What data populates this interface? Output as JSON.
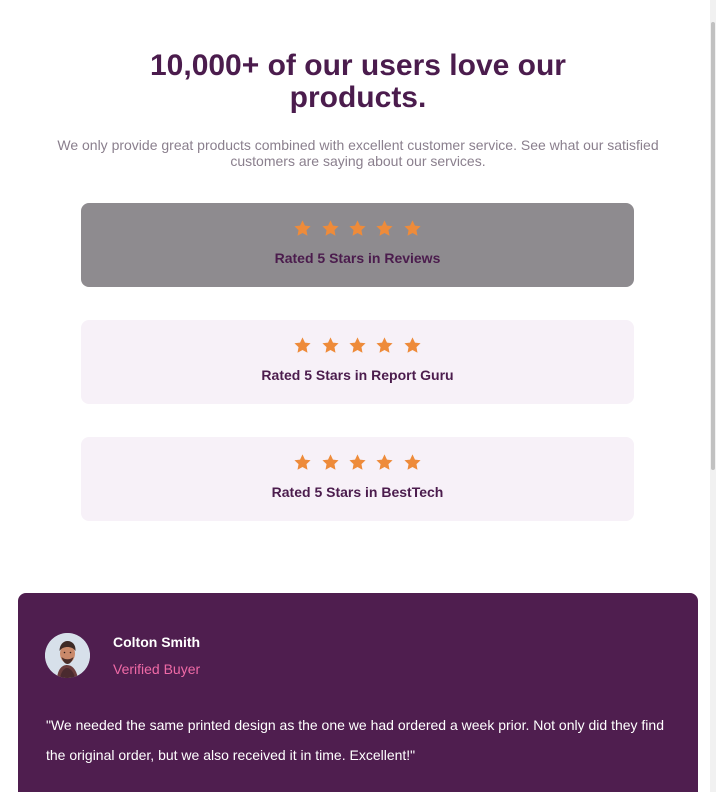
{
  "hero": {
    "title": "10,000+ of our users love our products.",
    "subtitle": "We only provide great products combined with excellent customer service. See what our satisfied customers are saying about our services."
  },
  "ratings": [
    {
      "stars": 5,
      "label": "Rated 5 Stars in Reviews"
    },
    {
      "stars": 5,
      "label": "Rated 5 Stars in Report Guru"
    },
    {
      "stars": 5,
      "label": "Rated 5 Stars in BestTech"
    }
  ],
  "testimonial": {
    "name": "Colton Smith",
    "status": "Verified Buyer",
    "quote": "\"We needed the same printed design as the one we had ordered a week prior. Not only did they find the original order, but we also received it in time. Excellent!\""
  },
  "icons": {
    "star": "star-icon",
    "avatar": "person-avatar"
  },
  "colors": {
    "brand": "#4b1c4d",
    "card": "#f7f1f8",
    "active_card": "#8e8b8f",
    "star": "#ee8b3a",
    "testimonial_bg": "#4f1e4f",
    "accent_pink": "#ef6aa6"
  }
}
